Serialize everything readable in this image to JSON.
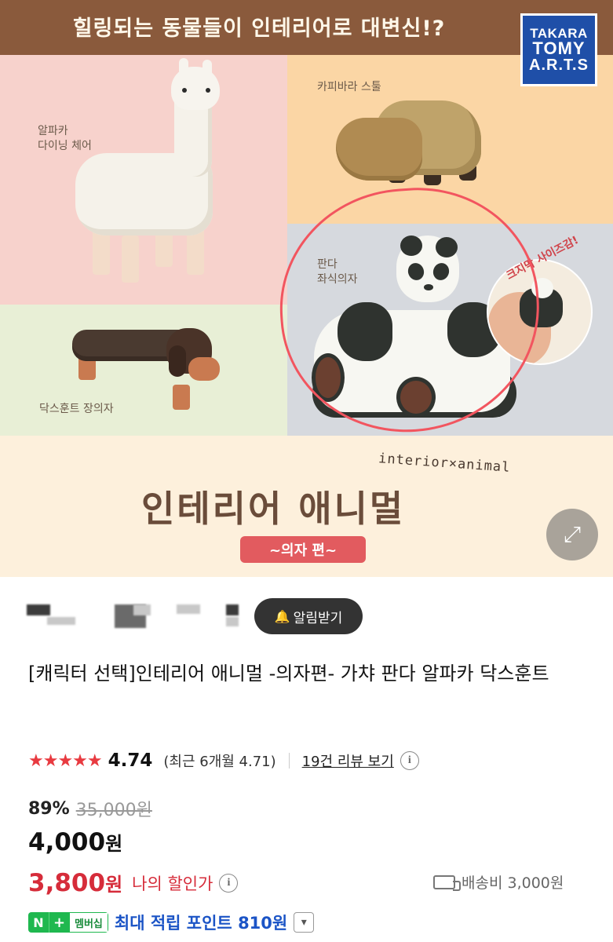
{
  "hero": {
    "headline": "힐링되는 동물들이 인테리어로 대변신!?",
    "brand_logo": [
      "TAKARA",
      "TOMY",
      "A.R.T.S"
    ],
    "labels": {
      "alpaca": "알파카\n다이닝 체어",
      "capybara": "카피바라 스툴",
      "panda": "판다\n좌식의자",
      "dachshund": "닥스훈트 장의자",
      "size_bubble": "크지막 사이즈감!"
    },
    "interior_tag": "interior×animal",
    "series_title": "인테리어 애니멀",
    "series_subtitle": "~의자 편~",
    "expand_icon": "expand-arrows-icon",
    "expand_glyph": "⤢"
  },
  "seller": {
    "notify_label": "알림받기",
    "notify_icon": "bell-plus-icon"
  },
  "product": {
    "title": "[캐릭터 선택]인테리어 애니멀 -의자편- 가챠 판다 알파카 닥스훈트",
    "stars": "★★★★★",
    "rating": "4.74",
    "recent_rating": "(최근 6개월 4.71)",
    "review_link": "19건 리뷰 보기",
    "discount_rate": "89%",
    "original_price": "35,000원",
    "sale_price_num": "4,000",
    "sale_price_unit": "원",
    "my_price_num": "3,800",
    "my_price_unit": "원",
    "my_price_label": "나의 할인가",
    "shipping": "배송비 3,000원",
    "points": {
      "badge_n": "N",
      "badge_plus": "+",
      "badge_member": "멤버십",
      "text": "최대 적립 포인트 810원"
    }
  },
  "colors": {
    "accent_red": "#d62c3a",
    "star_red": "#e83a40",
    "points_blue": "#1b54c6",
    "membership_green": "#1fb84f",
    "highlight_circle": "#f2555f"
  }
}
